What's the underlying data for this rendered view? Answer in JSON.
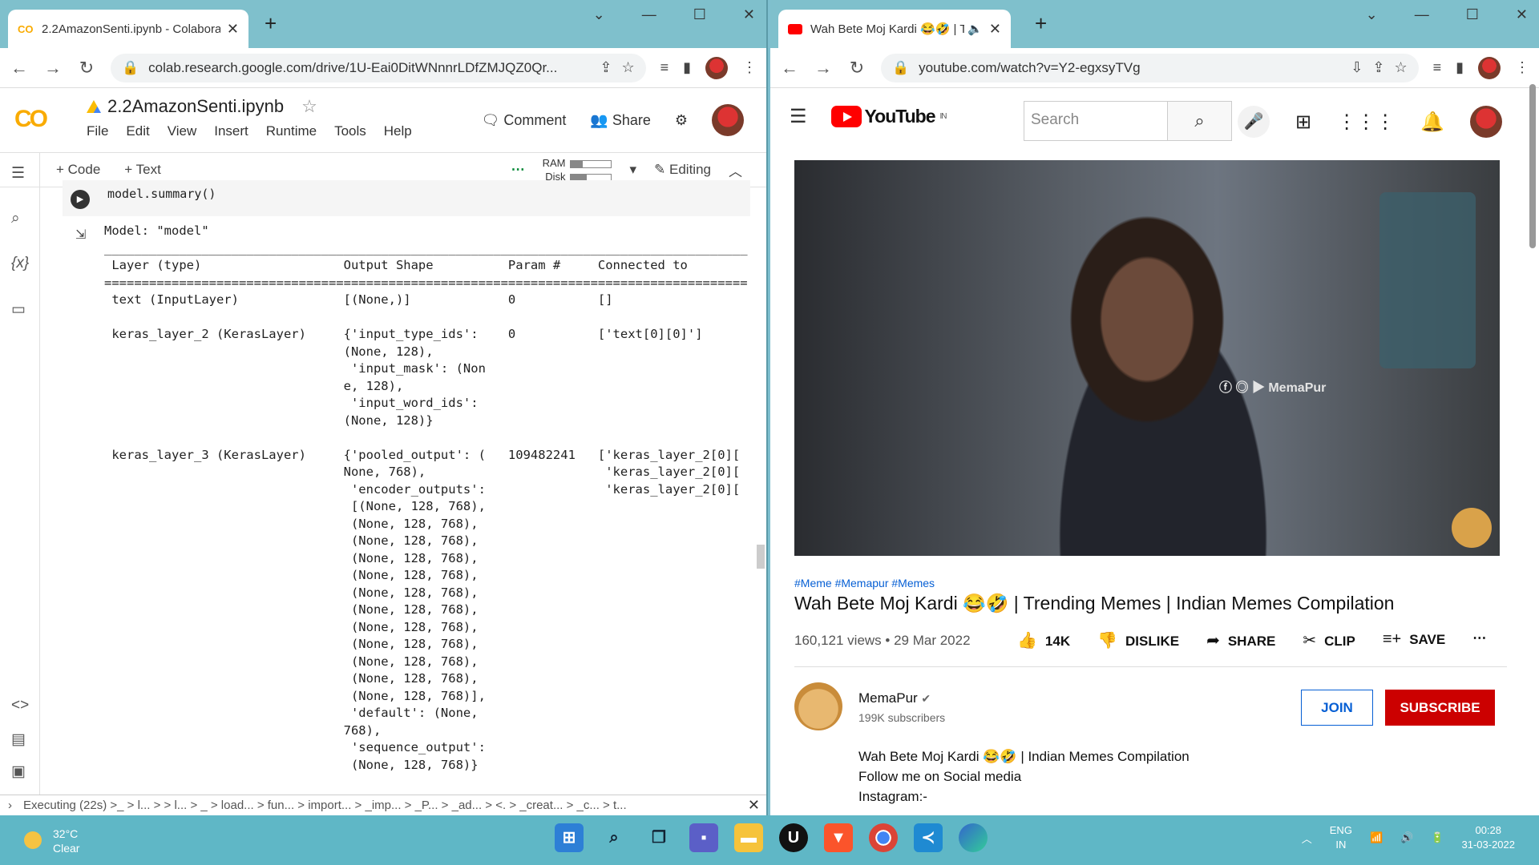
{
  "left": {
    "tab_title": "2.2AmazonSenti.ipynb - Colaboratory",
    "url": "colab.research.google.com/drive/1U-Eai0DitWNnnrLDfZMJQZ0Qr...",
    "notebook_name": "2.2AmazonSenti.ipynb",
    "menu": [
      "File",
      "Edit",
      "View",
      "Insert",
      "Runtime",
      "Tools",
      "Help"
    ],
    "comment": "Comment",
    "share": "Share",
    "add_code": "+ Code",
    "add_text": "+ Text",
    "ram_label": "RAM",
    "disk_label": "Disk",
    "editing": "Editing",
    "cell_code": "model.summary()",
    "output_text": "Model: \"model\"\n______________________________________________________________________________________\n Layer (type)                   Output Shape          Param #     Connected to\n======================================================================================\n text (InputLayer)              [(None,)]             0           []\n\n keras_layer_2 (KerasLayer)     {'input_type_ids':    0           ['text[0][0]']\n                                (None, 128),\n                                 'input_mask': (Non\n                                e, 128),\n                                 'input_word_ids':\n                                (None, 128)}\n\n keras_layer_3 (KerasLayer)     {'pooled_output': (   109482241   ['keras_layer_2[0][\n                                None, 768),                        'keras_layer_2[0][\n                                 'encoder_outputs':                'keras_layer_2[0][\n                                 [(None, 128, 768),\n                                 (None, 128, 768),\n                                 (None, 128, 768),\n                                 (None, 128, 768),\n                                 (None, 128, 768),\n                                 (None, 128, 768),\n                                 (None, 128, 768),\n                                 (None, 128, 768),\n                                 (None, 128, 768),\n                                 (None, 128, 768),\n                                 (None, 128, 768),\n                                 (None, 128, 768)],\n                                 'default': (None,\n                                768),\n                                 'sequence_output':\n                                 (None, 128, 768)}",
    "status": "Executing (22s)  >_ > l... > > l... > _ > load... > fun... > import... > _imp... > _P... > _ad... > <. > _creat... > _c... > t..."
  },
  "right": {
    "tab_title": "Wah Bete Moj Kardi 😂🤣 | T",
    "url": "youtube.com/watch?v=Y2-egxsyTVg",
    "logo_text": "YouTube",
    "logo_region": "IN",
    "search_placeholder": "Search",
    "watermark": "MemaPur",
    "hashtags": "#Meme #Memapur #Memes",
    "video_title": "Wah Bete Moj Kardi 😂🤣 | Trending Memes | Indian Memes Compilation",
    "views": "160,121 views • 29 Mar 2022",
    "likes": "14K",
    "dislike": "DISLIKE",
    "share": "SHARE",
    "clip": "CLIP",
    "save": "SAVE",
    "channel_name": "MemaPur",
    "subscribers": "199K subscribers",
    "join": "JOIN",
    "subscribe": "SUBSCRIBE",
    "desc_line1": "Wah Bete Moj Kardi 😂🤣 | Indian Memes Compilation",
    "desc_line2": "Follow me on Social media",
    "desc_line3": "Instagram:-"
  },
  "taskbar": {
    "temp": "32°C",
    "weather": "Clear",
    "lang1": "ENG",
    "lang2": "IN",
    "time": "00:28",
    "date": "31-03-2022"
  }
}
